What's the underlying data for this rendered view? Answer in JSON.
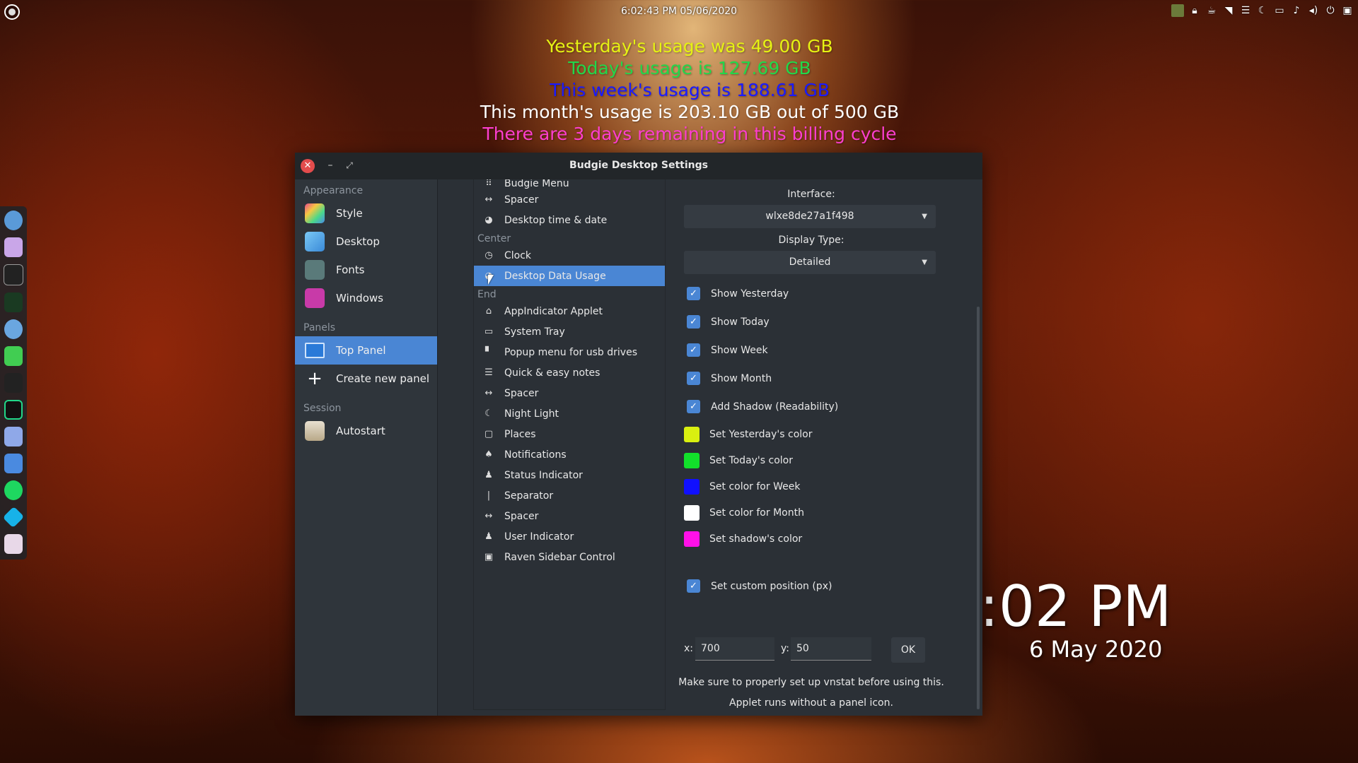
{
  "topbar": {
    "clock": "6:02:43 PM  05/06/2020",
    "tray_icons": [
      "app-icon",
      "lock-icon",
      "cup-icon",
      "wifi-icon",
      "notes-icon",
      "moon-icon",
      "places-icon",
      "bell-icon",
      "volume-icon",
      "power-icon",
      "raven-icon"
    ]
  },
  "usage": {
    "yesterday": "Yesterday's usage was 49.00 GB",
    "today": "Today's usage is 127.69 GB",
    "week": "This week's usage is 188.61 GB",
    "month": "This month's usage is 203.10 GB out of 500 GB",
    "remaining": "There are 3 days remaining in this billing cycle",
    "colors": {
      "yesterday": "#e6f213",
      "today": "#22d84a",
      "week": "#1a1aff",
      "month": "#ffffff",
      "remaining": "#ff3fd0"
    }
  },
  "desktop_clock": {
    "time": ":02 PM",
    "date": "6 May 2020"
  },
  "window": {
    "title": "Budgie Desktop Settings",
    "controls": {
      "close": "✕",
      "minimize": "–",
      "maximize": "⤢"
    }
  },
  "sidebar": {
    "appearance_header": "Appearance",
    "style": "Style",
    "desktop": "Desktop",
    "fonts": "Fonts",
    "windows": "Windows",
    "panels_header": "Panels",
    "top_panel": "Top Panel",
    "create_panel": "Create new panel",
    "session_header": "Session",
    "autostart": "Autostart"
  },
  "applets": {
    "start_items": [
      {
        "label": "Budgie Menu",
        "icon": "⠿"
      },
      {
        "label": "Spacer",
        "icon": "↔"
      },
      {
        "label": "Desktop time & date",
        "icon": "◕"
      }
    ],
    "center_header": "Center",
    "center_items": [
      {
        "label": "Clock",
        "icon": "◷"
      },
      {
        "label": "Desktop Data Usage",
        "icon": "◕"
      }
    ],
    "end_header": "End",
    "end_items": [
      {
        "label": "AppIndicator Applet",
        "icon": "⌂"
      },
      {
        "label": "System Tray",
        "icon": "▭"
      },
      {
        "label": "Popup menu for usb drives",
        "icon": "▘"
      },
      {
        "label": "Quick & easy notes",
        "icon": "☰"
      },
      {
        "label": "Spacer",
        "icon": "↔"
      },
      {
        "label": "Night Light",
        "icon": "☾"
      },
      {
        "label": "Places",
        "icon": "▢"
      },
      {
        "label": "Notifications",
        "icon": "♠"
      },
      {
        "label": "Status Indicator",
        "icon": "♟"
      },
      {
        "label": "Separator",
        "icon": "|"
      },
      {
        "label": "Spacer",
        "icon": "↔"
      },
      {
        "label": "User Indicator",
        "icon": "♟"
      },
      {
        "label": "Raven Sidebar Control",
        "icon": "▣"
      }
    ]
  },
  "settings": {
    "interface_label": "Interface:",
    "interface_value": "wlxe8de27a1f498",
    "display_type_label": "Display Type:",
    "display_type_value": "Detailed",
    "show_yesterday": "Show Yesterday",
    "show_today": "Show Today",
    "show_week": "Show Week",
    "show_month": "Show Month",
    "add_shadow": "Add Shadow (Readability)",
    "yesterday_color_label": "Set Yesterday's color",
    "today_color_label": "Set Today's color",
    "week_color_label": "Set color for Week",
    "month_color_label": "Set color for Month",
    "shadow_color_label": "Set shadow's color",
    "swatch_colors": {
      "yesterday": "#d9ef10",
      "today": "#12e02b",
      "week": "#1010ff",
      "month": "#ffffff",
      "shadow": "#ff10e8"
    },
    "custom_position_label": "Set custom position (px)",
    "x_label": "x:",
    "x_value": "700",
    "y_label": "y:",
    "y_value": "50",
    "ok_label": "OK",
    "note_line1": "Make sure to properly set up vnstat before using this.",
    "note_line2": "Applet runs without a panel icon."
  }
}
